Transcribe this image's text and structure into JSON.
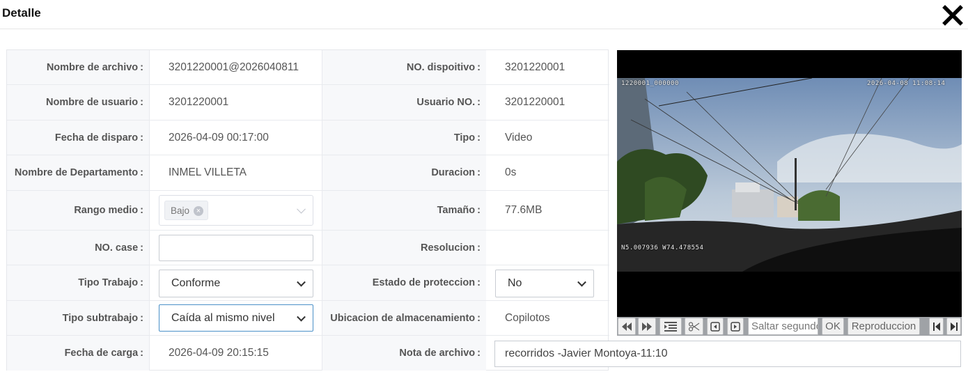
{
  "dialog": {
    "title": "Detalle"
  },
  "labels": {
    "file_name": "Nombre de archivo",
    "device_no": "NO. dispoitivo",
    "user_name": "Nombre de usuario",
    "user_no": "Usuario NO.",
    "trigger_date": "Fecha de disparo",
    "type": "Tipo",
    "department": "Nombre de Departamento",
    "duration": "Duracion",
    "range": "Rango medio",
    "size": "Tamaño",
    "case_no": "NO. case",
    "resolution": "Resolucion",
    "work_type": "Tipo Trabajo",
    "protection": "Estado de proteccion",
    "subwork_type": "Tipo subtrabajo",
    "storage": "Ubicacion de almacenamiento",
    "upload_date": "Fecha de carga",
    "file_note": "Nota de archivo"
  },
  "values": {
    "file_name": "3201220001@2026040811",
    "device_no": "3201220001",
    "user_name": "3201220001",
    "user_no": "3201220001",
    "trigger_date": "2026-04-09 00:17:00",
    "type": "Video",
    "department": "INMEL VILLETA",
    "duration": "0s",
    "range_tag": "Bajo",
    "size": "77.6MB",
    "case_no": "",
    "resolution": "",
    "work_type": "Conforme",
    "protection": "No",
    "subwork_type": "Caída al mismo nivel",
    "storage": "Copilotos",
    "upload_date": "2026-04-09 20:15:15",
    "file_note": "recorridos -Javier Montoya-11:10"
  },
  "video": {
    "osd_id": "1220001_000000",
    "osd_time": "2026-04-08 11:08:14",
    "osd_gps": "N5.007936  W74.478554"
  },
  "player": {
    "seek_placeholder": "Saltar segundos",
    "ok_label": "OK",
    "playback_label": "Reproduccion"
  },
  "colors": {
    "sky": "#8ea6c4",
    "ground": "#1a1a1a",
    "accent_border": "#4a90c8",
    "label_bg": "#f7f8fa"
  }
}
